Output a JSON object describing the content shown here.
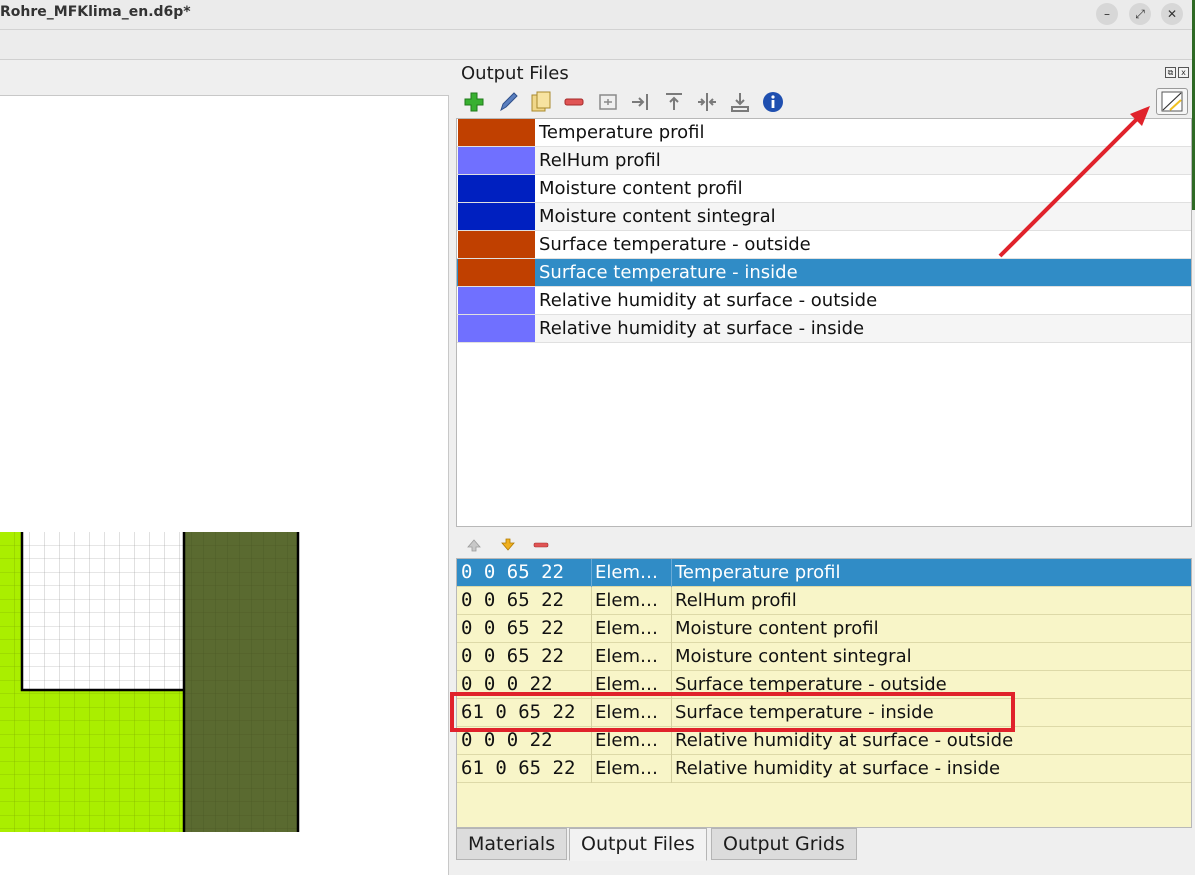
{
  "window": {
    "title": "Rohre_MFKlima_en.d6p*",
    "buttons": {
      "minimize": "–",
      "maximize": "⤢",
      "close": "✕"
    }
  },
  "dock": {
    "title": "Output Files",
    "float_glyph": "⧉",
    "close_glyph": "x",
    "toolbar_icons": [
      "add-icon",
      "edit-icon",
      "copy-icon",
      "remove-icon",
      "rename-icon",
      "align-right-icon",
      "align-top-icon",
      "align-center-icon",
      "import-icon",
      "info-icon"
    ],
    "diagram_button_icon": "diagram-icon"
  },
  "output_files": [
    {
      "label": "Temperature profil",
      "color": "#c04000"
    },
    {
      "label": "RelHum profil",
      "color": "#7070ff"
    },
    {
      "label": "Moisture content profil",
      "color": "#0020c0"
    },
    {
      "label": "Moisture content sintegral",
      "color": "#0020c0"
    },
    {
      "label": "Surface temperature - outside",
      "color": "#c04000"
    },
    {
      "label": "Surface temperature - inside",
      "color": "#c04000",
      "selected": true
    },
    {
      "label": "Relative humidity at surface - outside",
      "color": "#7070ff"
    },
    {
      "label": "Relative humidity at surface - inside",
      "color": "#7070ff"
    }
  ],
  "assignment_toolbar": [
    "move-up-icon",
    "move-down-icon",
    "remove-icon"
  ],
  "assignments": [
    {
      "index": "0 0 65 22",
      "type": "Elem…",
      "name": "Temperature profil",
      "selected": true
    },
    {
      "index": "0 0 65 22",
      "type": "Elem…",
      "name": "RelHum profil"
    },
    {
      "index": "0 0 65 22",
      "type": "Elem…",
      "name": "Moisture content profil"
    },
    {
      "index": "0 0 65 22",
      "type": "Elem…",
      "name": "Moisture content sintegral"
    },
    {
      "index": "0 0 0 22",
      "type": "Elem…",
      "name": "Surface temperature - outside"
    },
    {
      "index": "61 0 65 22",
      "type": "Elem…",
      "name": "Surface temperature - inside"
    },
    {
      "index": "0 0 0 22",
      "type": "Elem…",
      "name": "Relative humidity at surface - outside"
    },
    {
      "index": "61 0 65 22",
      "type": "Elem…",
      "name": "Relative humidity at surface - inside"
    }
  ],
  "tabs": [
    {
      "label": "Materials"
    },
    {
      "label": "Output Files",
      "active": true
    },
    {
      "label": "Output Grids"
    }
  ],
  "colors": {
    "selection": "#308cc6",
    "material_light_green": "#aaee00",
    "material_dark_green": "#5a6a30",
    "annotation_red": "#e0222b"
  }
}
